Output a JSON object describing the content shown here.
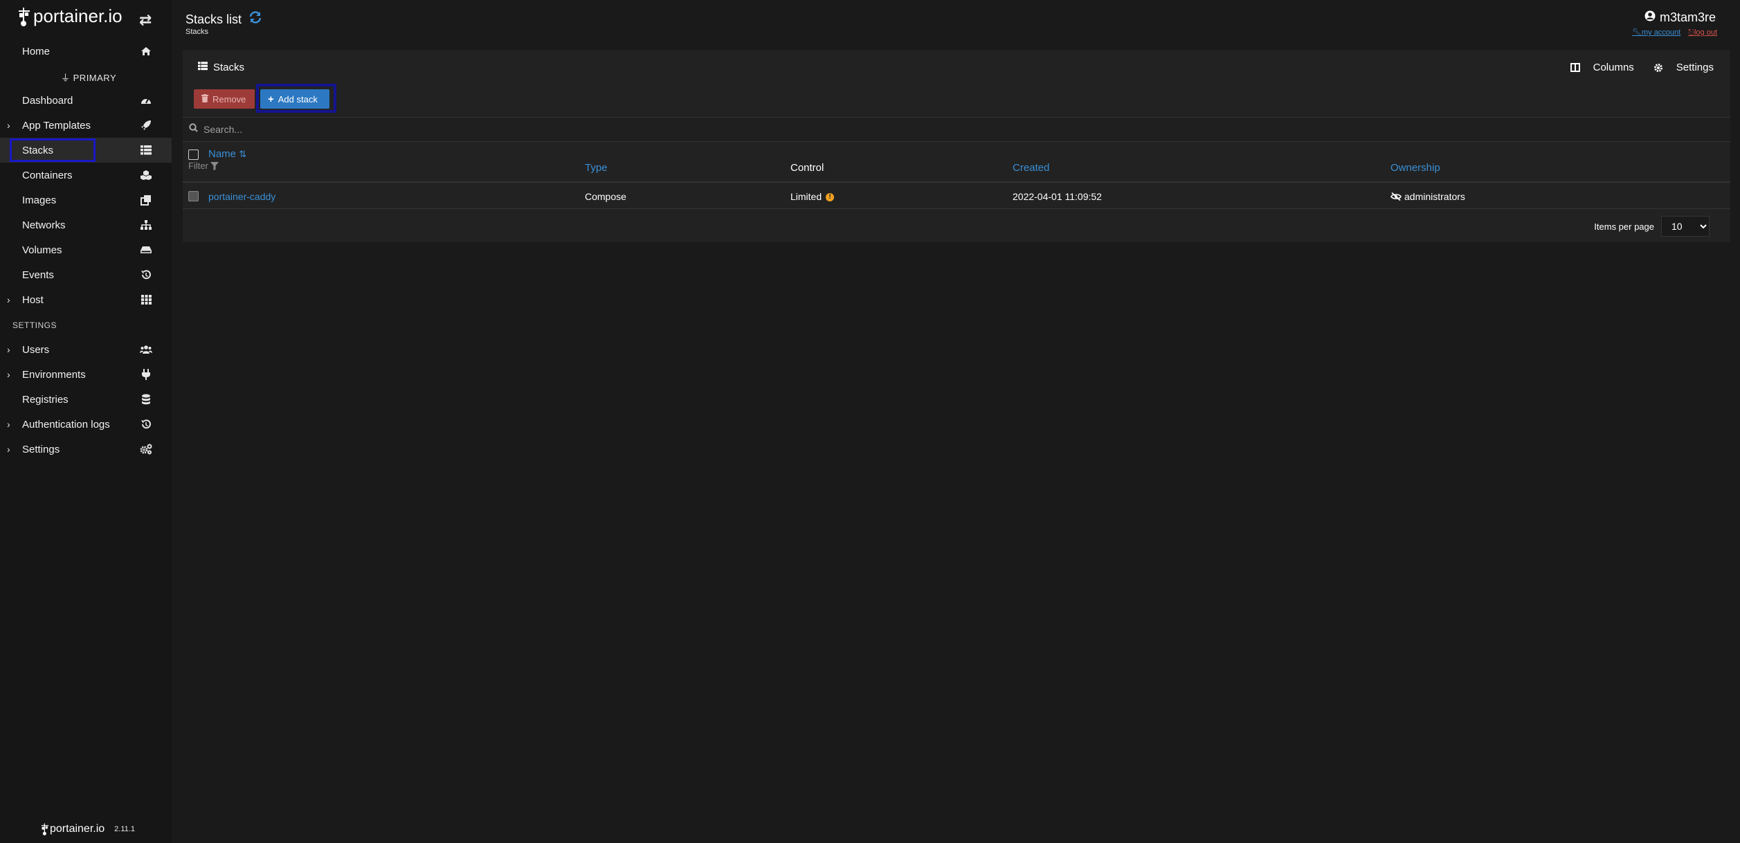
{
  "app": {
    "brand": "portainer.io",
    "version": "2.11.1"
  },
  "sidebar": {
    "home": "Home",
    "environment_header": "PRIMARY",
    "items": [
      {
        "label": "Dashboard",
        "icon": "tachometer-icon"
      },
      {
        "label": "App Templates",
        "icon": "rocket-icon",
        "expandable": true
      },
      {
        "label": "Stacks",
        "icon": "th-list-icon",
        "active": true
      },
      {
        "label": "Containers",
        "icon": "cubes-icon"
      },
      {
        "label": "Images",
        "icon": "clone-icon"
      },
      {
        "label": "Networks",
        "icon": "sitemap-icon"
      },
      {
        "label": "Volumes",
        "icon": "hdd-icon"
      },
      {
        "label": "Events",
        "icon": "history-icon"
      },
      {
        "label": "Host",
        "icon": "th-icon",
        "expandable": true
      }
    ],
    "settings_header": "SETTINGS",
    "settings_items": [
      {
        "label": "Users",
        "icon": "users-icon",
        "expandable": true
      },
      {
        "label": "Environments",
        "icon": "plug-icon",
        "expandable": true
      },
      {
        "label": "Registries",
        "icon": "database-icon"
      },
      {
        "label": "Authentication logs",
        "icon": "history-icon",
        "expandable": true
      },
      {
        "label": "Settings",
        "icon": "cogs-icon",
        "expandable": true
      }
    ]
  },
  "header": {
    "title": "Stacks list",
    "breadcrumb": "Stacks",
    "username": "m3tam3re",
    "my_account": "my account",
    "log_out": "log out"
  },
  "panel": {
    "title": "Stacks",
    "columns_label": "Columns",
    "settings_label": "Settings",
    "remove_label": "Remove",
    "add_label": "Add stack",
    "search_placeholder": "Search...",
    "filter_label": "Filter",
    "columns": {
      "name": "Name",
      "type": "Type",
      "control": "Control",
      "created": "Created",
      "ownership": "Ownership"
    },
    "rows": [
      {
        "name": "portainer-caddy",
        "type": "Compose",
        "control": "Limited",
        "created": "2022-04-01 11:09:52",
        "ownership": "administrators"
      }
    ],
    "items_per_page_label": "Items per page",
    "items_per_page_value": "10"
  },
  "colors": {
    "accent": "#3a8fd6",
    "danger": "#9d3b38",
    "primary_button": "#2c78c2",
    "focus_outline": "#1818c8"
  }
}
